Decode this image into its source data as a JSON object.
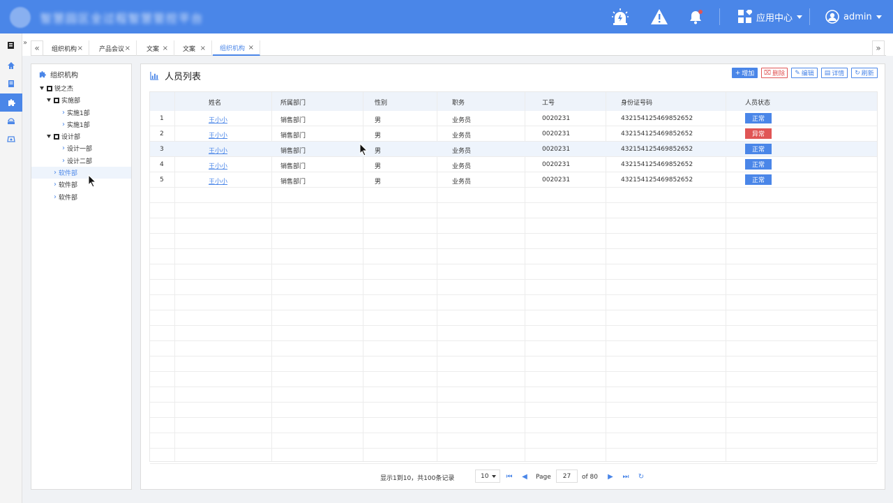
{
  "header": {
    "title": "智慧园区全过程智慧管控平台",
    "app_center_label": "应用中心",
    "user_label": "admin",
    "colors": {
      "bar": "#4a86e8",
      "danger": "#e05555"
    }
  },
  "tabs": [
    {
      "label": "组织机构",
      "active": false
    },
    {
      "label": "产品会议",
      "active": false
    },
    {
      "label": "文案",
      "active": false
    },
    {
      "label": "文案",
      "active": false
    },
    {
      "label": "组织机构",
      "active": true
    }
  ],
  "tree": {
    "title": "组织机构",
    "nodes": [
      {
        "label": "锐之杰"
      },
      {
        "label": "实施部"
      },
      {
        "label": "实施1部"
      },
      {
        "label": "实施1部"
      },
      {
        "label": "设计部"
      },
      {
        "label": "设计一部"
      },
      {
        "label": "设计二部"
      },
      {
        "label": "软件部"
      },
      {
        "label": "软件部"
      },
      {
        "label": "软件部"
      }
    ]
  },
  "main": {
    "title": "人员列表",
    "buttons": {
      "add": "增加",
      "delete": "删除",
      "edit": "编辑",
      "detail": "详情",
      "refresh": "刷新"
    },
    "columns": [
      "姓名",
      "所属部门",
      "性别",
      "职务",
      "工号",
      "身份证号码",
      "人员状态"
    ],
    "rows": [
      {
        "idx": "1",
        "name": "王小小",
        "dept": "销售部门",
        "gender": "男",
        "role": "业务员",
        "empno": "0020231",
        "idcard": "432154125469852652",
        "status": "正常",
        "status_color": "#4a86e8"
      },
      {
        "idx": "2",
        "name": "王小小",
        "dept": "销售部门",
        "gender": "男",
        "role": "业务员",
        "empno": "0020231",
        "idcard": "432154125469852652",
        "status": "异常",
        "status_color": "#e05555"
      },
      {
        "idx": "3",
        "name": "王小小",
        "dept": "销售部门",
        "gender": "男",
        "role": "业务员",
        "empno": "0020231",
        "idcard": "432154125469852652",
        "status": "正常",
        "status_color": "#4a86e8"
      },
      {
        "idx": "4",
        "name": "王小小",
        "dept": "销售部门",
        "gender": "男",
        "role": "业务员",
        "empno": "0020231",
        "idcard": "432154125469852652",
        "status": "正常",
        "status_color": "#4a86e8"
      },
      {
        "idx": "5",
        "name": "王小小",
        "dept": "销售部门",
        "gender": "男",
        "role": "业务员",
        "empno": "0020231",
        "idcard": "432154125469852652",
        "status": "正常",
        "status_color": "#4a86e8"
      }
    ]
  },
  "pager": {
    "summary": "显示1到10，共100条记录",
    "page_size": "10",
    "page_label": "Page",
    "current_page": "27",
    "of_label": "of 80"
  }
}
